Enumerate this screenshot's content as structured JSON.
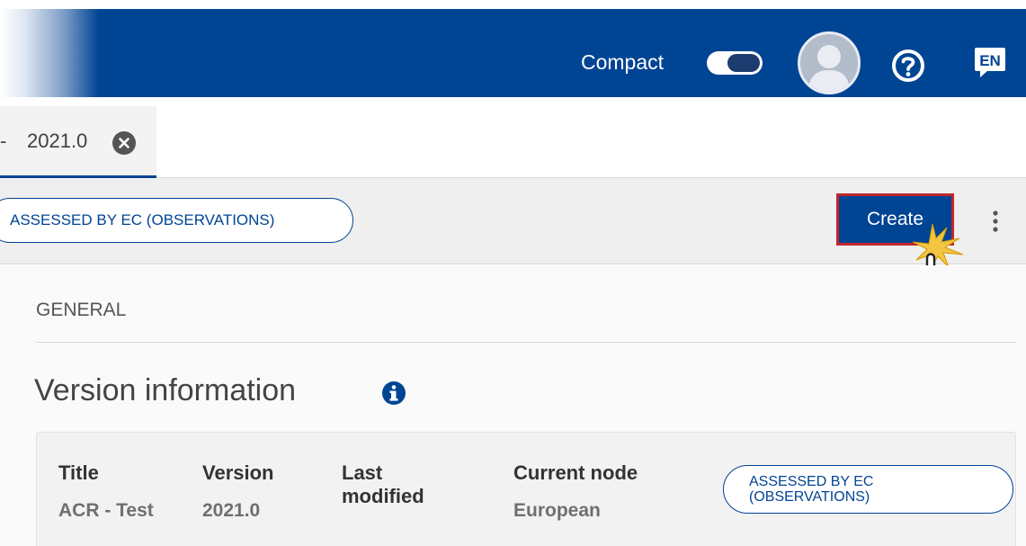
{
  "header": {
    "compact_label": "Compact",
    "compact_toggle_on": false,
    "language": "EN",
    "brand_color": "#004494"
  },
  "tab": {
    "label": "2021.0"
  },
  "toolbar": {
    "status_badge": "ASSESSED BY EC (OBSERVATIONS)",
    "create_label": "Create",
    "highlight_color": "#c0262d"
  },
  "section": {
    "label": "GENERAL",
    "title": "Version information"
  },
  "version_card": {
    "headers": {
      "title": "Title",
      "version": "Version",
      "last_modified": "Last modified",
      "current_node": "Current node"
    },
    "values": {
      "title": "ACR - Test",
      "version": "2021.0",
      "current_node": "European"
    },
    "status_line1": "ASSESSED BY EC",
    "status_line2": "(OBSERVATIONS)"
  }
}
